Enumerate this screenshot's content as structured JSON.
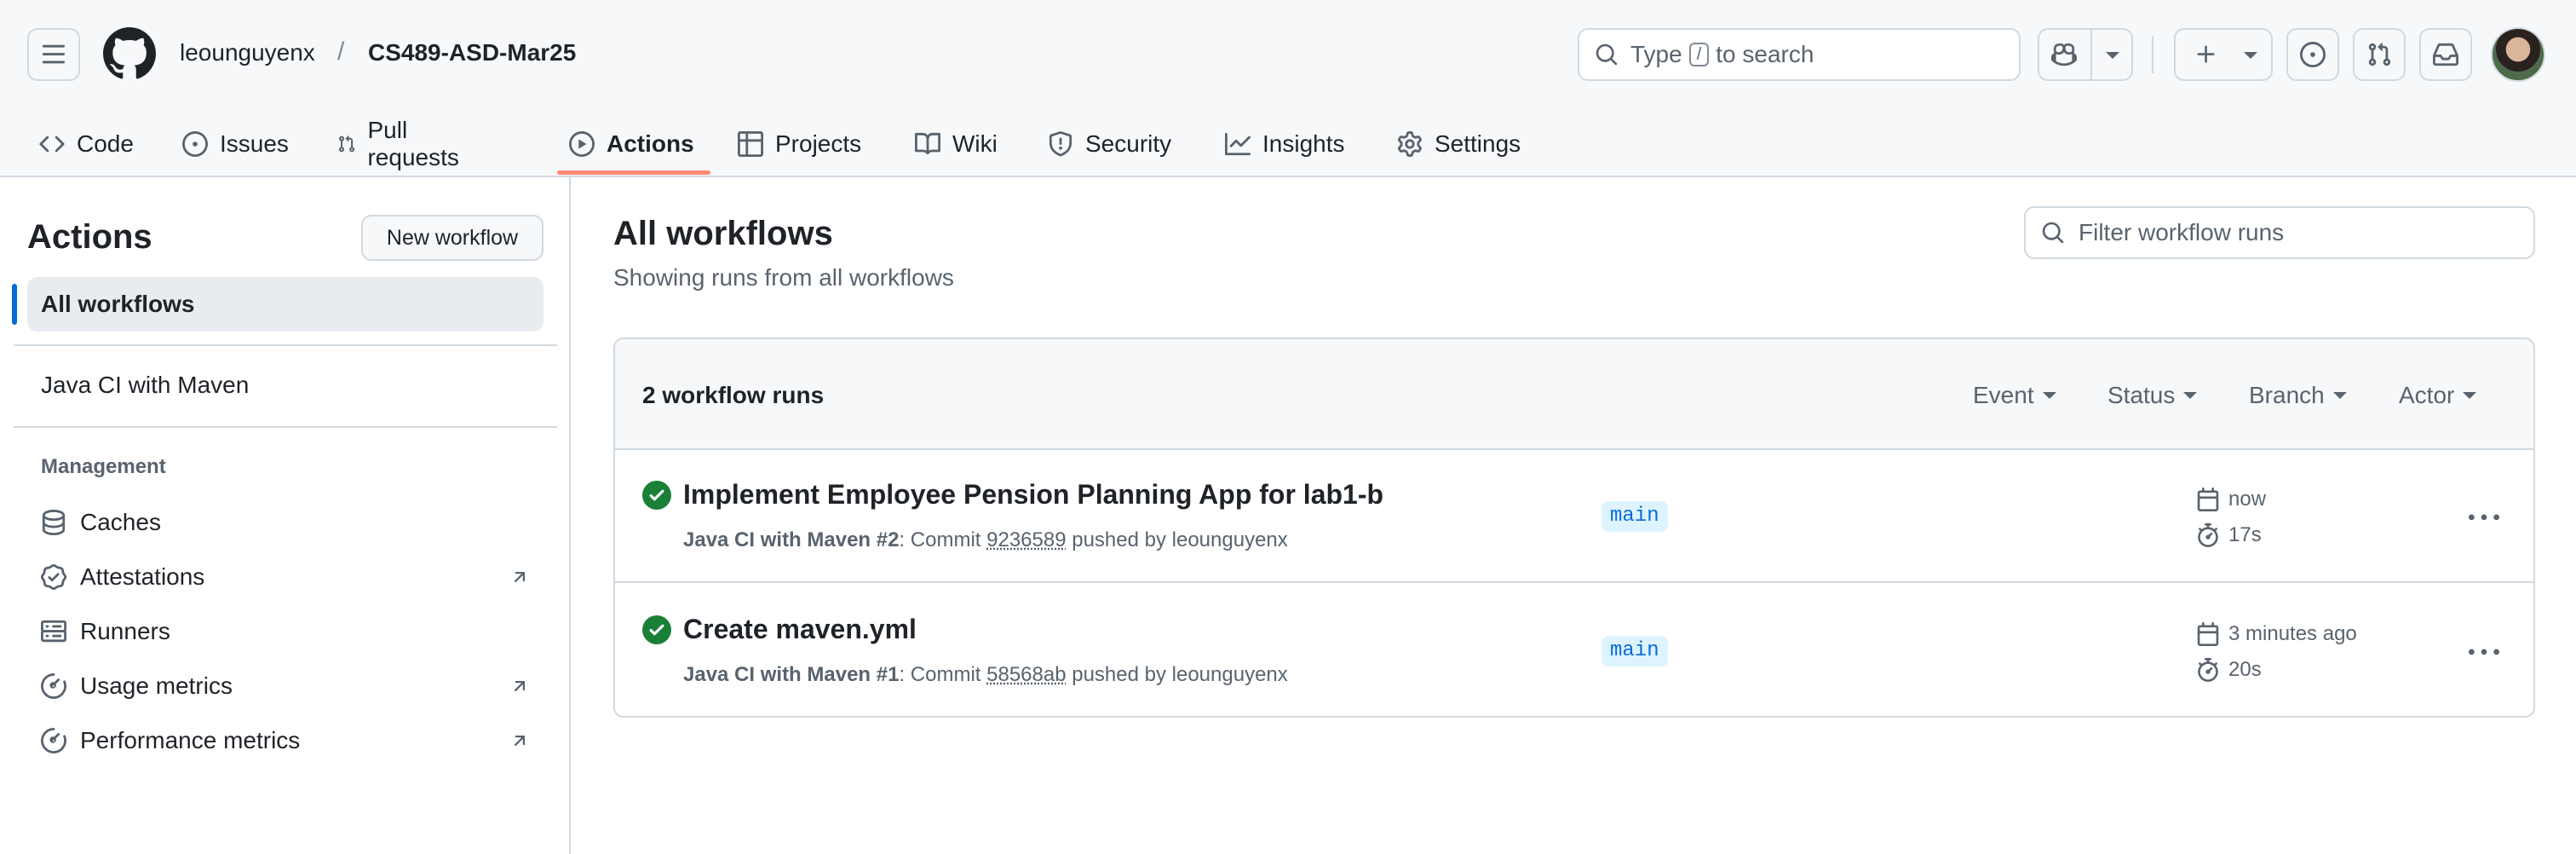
{
  "header": {
    "owner": "leounguyenx",
    "separator": "/",
    "repo": "CS489-ASD-Mar25",
    "search": {
      "prefix": "Type",
      "key": "/",
      "suffix": "to search"
    }
  },
  "tabs": [
    {
      "label": "Code",
      "icon": "code-icon"
    },
    {
      "label": "Issues",
      "icon": "issue-opened-icon"
    },
    {
      "label": "Pull requests",
      "icon": "git-pull-request-icon"
    },
    {
      "label": "Actions",
      "icon": "play-icon",
      "active": true
    },
    {
      "label": "Projects",
      "icon": "table-icon"
    },
    {
      "label": "Wiki",
      "icon": "book-icon"
    },
    {
      "label": "Security",
      "icon": "shield-icon"
    },
    {
      "label": "Insights",
      "icon": "graph-icon"
    },
    {
      "label": "Settings",
      "icon": "gear-icon"
    }
  ],
  "sidebar": {
    "title": "Actions",
    "new_workflow": "New workflow",
    "all_workflows": "All workflows",
    "workflows": [
      "Java CI with Maven"
    ],
    "management_heading": "Management",
    "management": [
      {
        "label": "Caches",
        "icon": "database-icon",
        "external": false
      },
      {
        "label": "Attestations",
        "icon": "verified-icon",
        "external": true
      },
      {
        "label": "Runners",
        "icon": "server-icon",
        "external": false
      },
      {
        "label": "Usage metrics",
        "icon": "meter-icon",
        "external": true
      },
      {
        "label": "Performance metrics",
        "icon": "meter-icon",
        "external": true
      }
    ]
  },
  "main": {
    "title": "All workflows",
    "subtitle": "Showing runs from all workflows",
    "filter_placeholder": "Filter workflow runs",
    "runs_count": "2 workflow runs",
    "filters": [
      "Event",
      "Status",
      "Branch",
      "Actor"
    ],
    "runs": [
      {
        "title": "Implement Employee Pension Planning App for lab1-b",
        "workflow": "Java CI with Maven",
        "run_number": "#2",
        "commit_prefix": ": Commit",
        "sha": "9236589",
        "pushed_by": "pushed by leounguyenx",
        "branch": "main",
        "when": "now",
        "duration": "17s",
        "status": "success"
      },
      {
        "title": "Create maven.yml",
        "workflow": "Java CI with Maven",
        "run_number": "#1",
        "commit_prefix": ": Commit",
        "sha": "58568ab",
        "pushed_by": "pushed by leounguyenx",
        "branch": "main",
        "when": "3 minutes ago",
        "duration": "20s",
        "status": "success"
      }
    ]
  },
  "colors": {
    "accent_underline": "#fd8c73",
    "success": "#1a7f37",
    "link_blue": "#0969da"
  }
}
